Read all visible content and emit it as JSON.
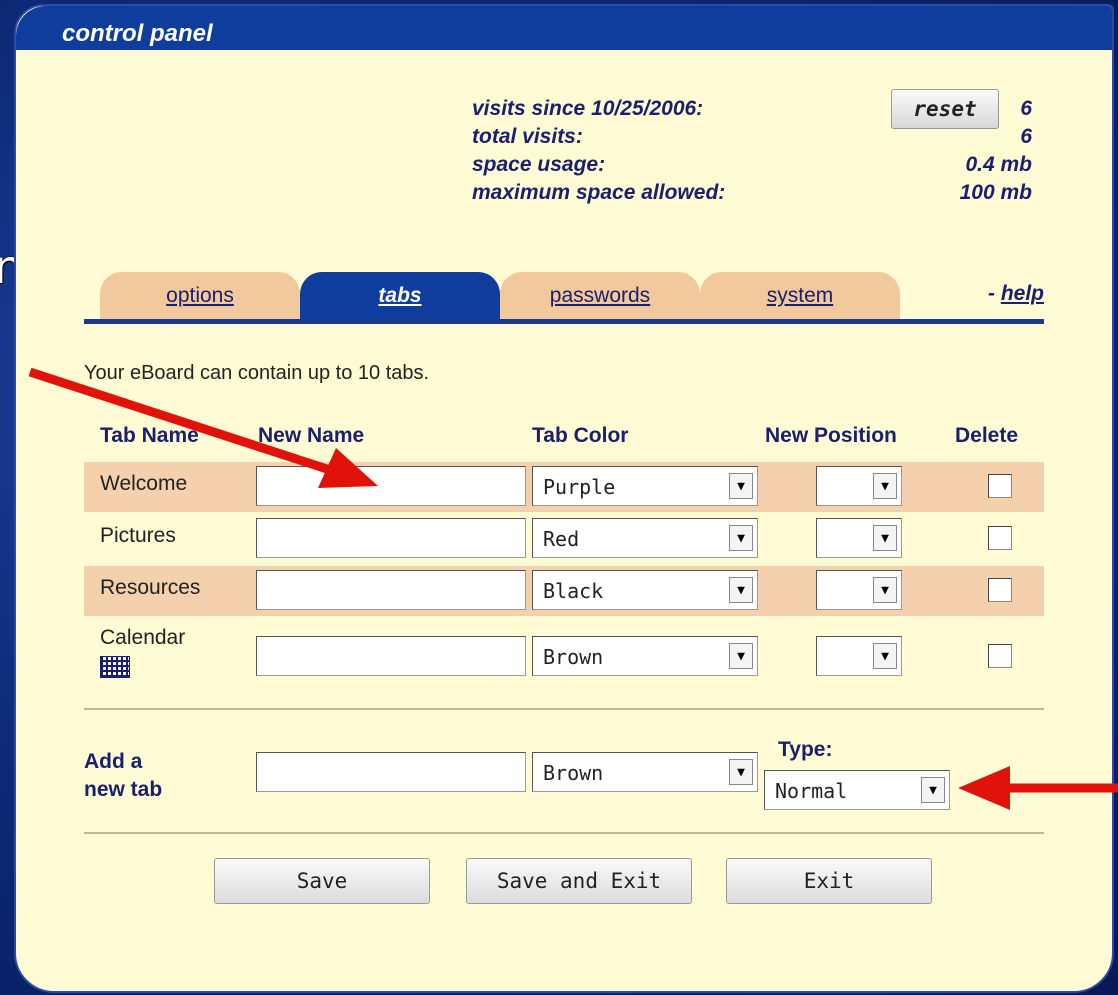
{
  "background": {
    "partial_word": "ng"
  },
  "panel": {
    "title": "control panel"
  },
  "stats": {
    "visits_since_label": "visits since 10/25/2006:",
    "visits_since_value": "6",
    "reset_label": "reset",
    "total_visits_label": "total visits:",
    "total_visits_value": "6",
    "space_usage_label": "space usage:",
    "space_usage_value": "0.4 mb",
    "max_space_label": "maximum space allowed:",
    "max_space_value": "100 mb"
  },
  "tabs": {
    "items": [
      "options",
      "tabs",
      "passwords",
      "system"
    ],
    "active": "tabs",
    "help_prefix": "- ",
    "help_label": "help"
  },
  "info_text": "Your eBoard can contain up to 10 tabs.",
  "table": {
    "headers": [
      "Tab Name",
      "New Name",
      "Tab Color",
      "New Position",
      "Delete"
    ],
    "rows": [
      {
        "name": "Welcome",
        "new_name": "",
        "color": "Purple",
        "position": "",
        "delete": false
      },
      {
        "name": "Pictures",
        "new_name": "",
        "color": "Red",
        "position": "",
        "delete": false
      },
      {
        "name": "Resources",
        "new_name": "",
        "color": "Black",
        "position": "",
        "delete": false
      },
      {
        "name": "Calendar",
        "new_name": "",
        "color": "Brown",
        "position": "",
        "delete": false
      }
    ]
  },
  "add_tab": {
    "label_line1": "Add a",
    "label_line2": "new tab",
    "name_value": "",
    "color": "Brown",
    "type_label": "Type:",
    "type_value": "Normal"
  },
  "buttons": {
    "save": "Save",
    "save_exit": "Save and Exit",
    "exit": "Exit"
  },
  "colors": {
    "header": "#0f3d9e",
    "panel_bg": "#fffbd4",
    "row_tint": "#f5d0ac",
    "arrow": "#e0120a"
  }
}
